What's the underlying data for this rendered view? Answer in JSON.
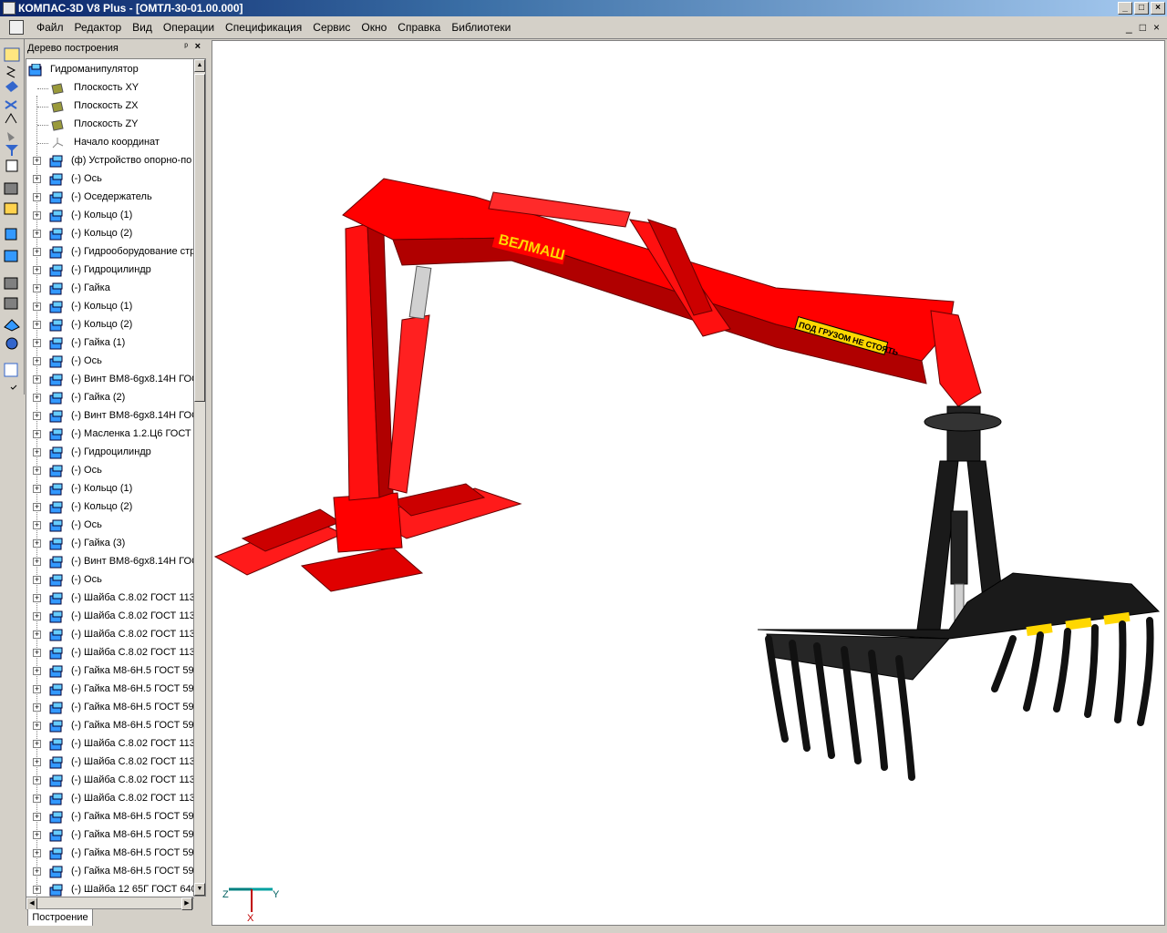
{
  "window": {
    "title": "КОМПАС-3D V8 Plus - [ОМТЛ-30-01.00.000]",
    "controls": [
      "_",
      "□",
      "×"
    ]
  },
  "menubar": {
    "items": [
      "Файл",
      "Редактор",
      "Вид",
      "Операции",
      "Спецификация",
      "Сервис",
      "Окно",
      "Справка",
      "Библиотеки"
    ],
    "doc_controls": [
      "_",
      "□",
      "×"
    ]
  },
  "tree_panel": {
    "title": "Дерево построения",
    "pin_glyph": "ᵖ",
    "close_glyph": "×",
    "root": "Гидроманипулятор",
    "base_items": [
      "Плоскость XY",
      "Плоскость ZX",
      "Плоскость ZY",
      "Начало координат"
    ],
    "items": [
      "(ф) Устройство опорно-по",
      "(-) Ось",
      "(-) Оседержатель",
      "(-) Кольцо (1)",
      "(-) Кольцо (2)",
      "(-) Гидрооборудование стр",
      "(-) Гидроцилиндр",
      "(-) Гайка",
      "(-) Кольцо (1)",
      "(-) Кольцо (2)",
      "(-) Гайка (1)",
      "(-) Ось",
      "(-) Винт ВМ8-6gx8.14Н ГОС",
      "(-) Гайка (2)",
      "(-) Винт ВМ8-6gx8.14Н ГОС",
      "(-) Масленка 1.2.Ц6 ГОСТ",
      "(-) Гидроцилиндр",
      "(-) Ось",
      "(-) Кольцо (1)",
      "(-) Кольцо (2)",
      "(-) Ось",
      "(-) Гайка (3)",
      "(-) Винт ВМ8-6gx8.14Н ГОС",
      "(-) Ось",
      "(-) Шайба С.8.02 ГОСТ 113",
      "(-) Шайба С.8.02 ГОСТ 113",
      "(-) Шайба С.8.02 ГОСТ 113",
      "(-) Шайба С.8.02 ГОСТ 113",
      "(-) Гайка М8-6Н.5 ГОСТ 59",
      "(-) Гайка М8-6Н.5 ГОСТ 59",
      "(-) Гайка М8-6Н.5 ГОСТ 59",
      "(-) Гайка М8-6Н.5 ГОСТ 59",
      "(-) Шайба С.8.02 ГОСТ 113",
      "(-) Шайба С.8.02 ГОСТ 113",
      "(-) Шайба С.8.02 ГОСТ 113",
      "(-) Шайба С.8.02 ГОСТ 113",
      "(-) Гайка М8-6Н.5 ГОСТ 59",
      "(-) Гайка М8-6Н.5 ГОСТ 59",
      "(-) Гайка М8-6Н.5 ГОСТ 59",
      "(-) Гайка М8-6Н.5 ГОСТ 59",
      "(-) Шайба 12 65Г ГОСТ 640"
    ],
    "tab_label": "Построение"
  },
  "viewport": {
    "model_label_brand": "ВЕЛМАШ",
    "model_label_warning": "ПОД ГРУЗОМ НЕ СТОЯТЬ",
    "axes": {
      "x": "X",
      "y": "Y",
      "z": "Z"
    },
    "colors": {
      "boom": "#ff0000",
      "boom_dark": "#8b0000",
      "grapple": "#1a1a1a",
      "label_yellow": "#ffd700"
    }
  }
}
